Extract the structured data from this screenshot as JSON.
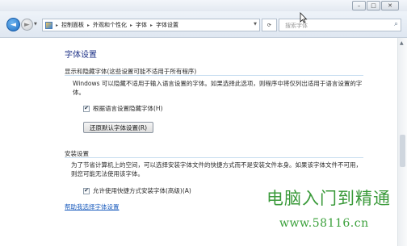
{
  "window": {
    "minimize_glyph": "–",
    "maximize_glyph": "□",
    "close_glyph": "✕"
  },
  "address": {
    "breadcrumbs": [
      "控制面板",
      "外观和个性化",
      "字体",
      "字体设置"
    ],
    "separator": "▸",
    "search_placeholder": "搜索字体"
  },
  "main": {
    "title": "字体设置",
    "section1": {
      "heading": "显示和隐藏字体(这些设置可能不适用于所有程序)",
      "description": "Windows 可以隐藏不适用于输入语言设置的字体。如果选择此选项，则程序中将仅列出适用于语言设置的字体。",
      "checkbox_label": "根据语言设置隐藏字体(H)",
      "checkbox_checked": true,
      "restore_button": "还原默认字体设置(R)"
    },
    "section2": {
      "heading": "安装设置",
      "description": "为了节省计算机上的空间，可以选择安装字体文件的快捷方式而不是安装文件本身。如果该字体文件不可用，则您可能无法使用该字体。",
      "checkbox_label": "允许使用快捷方式安装字体(高级)(A)",
      "checkbox_checked": true
    },
    "help_link": "帮助我选择字体设置"
  },
  "watermark": {
    "line1": "电脑入门到精通",
    "line2": "www.58116.cn"
  },
  "colors": {
    "title_blue": "#1e3287",
    "link_blue": "#1f5fbf",
    "watermark_green": "#3a9a3a",
    "rule_blue": "#c7ddf0"
  }
}
